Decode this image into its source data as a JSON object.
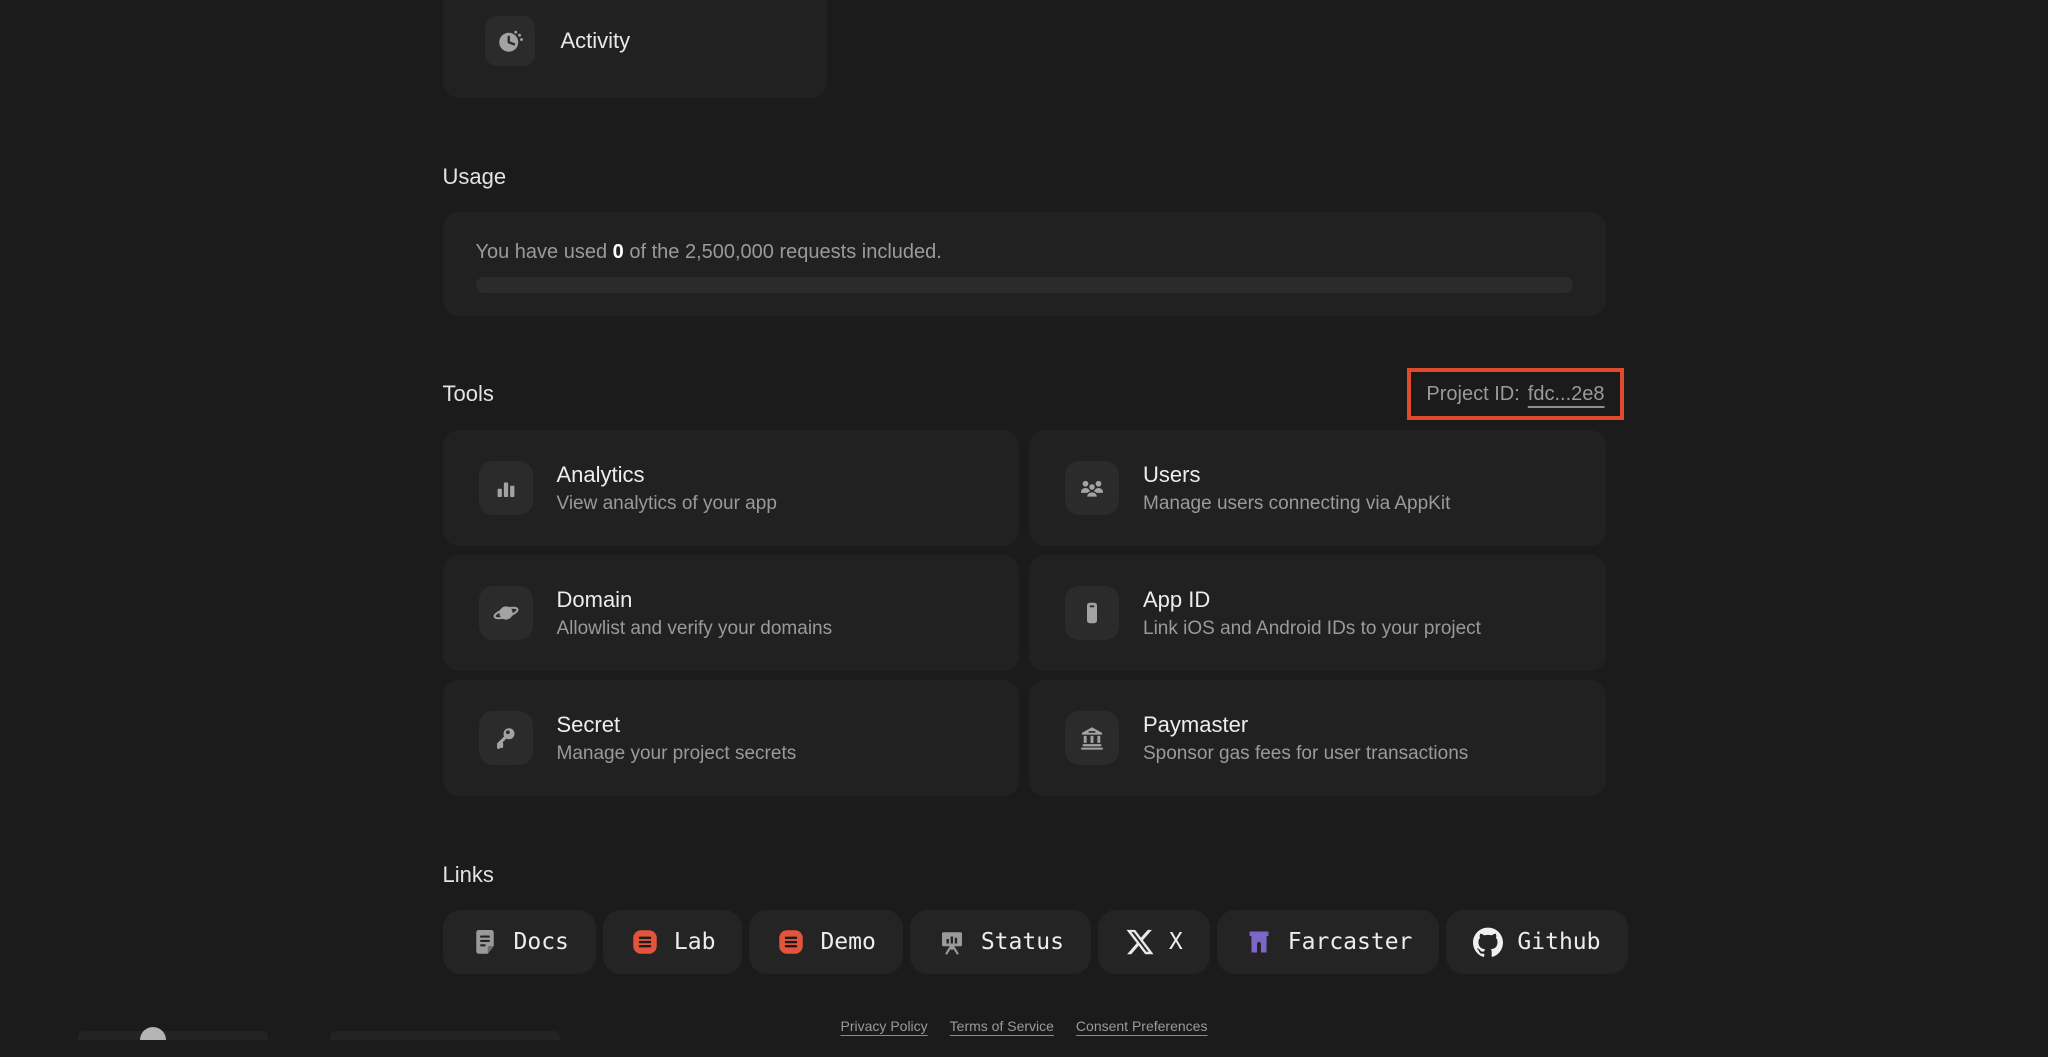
{
  "activity_card": {
    "label": "Activity",
    "icon": "activity-icon"
  },
  "usage": {
    "heading": "Usage",
    "text_prefix": "You have used ",
    "used_value": "0",
    "text_suffix": " of the 2,500,000 requests included.",
    "progress_percent": 0
  },
  "tools": {
    "heading": "Tools",
    "project_id": {
      "label": "Project ID:",
      "value": "fdc...2e8",
      "highlight_color": "#e04a2e"
    },
    "cards": [
      {
        "title": "Analytics",
        "description": "View analytics of your app",
        "icon": "analytics-icon"
      },
      {
        "title": "Users",
        "description": "Manage users connecting via AppKit",
        "icon": "users-icon"
      },
      {
        "title": "Domain",
        "description": "Allowlist and verify your domains",
        "icon": "domain-icon"
      },
      {
        "title": "App ID",
        "description": "Link iOS and Android IDs to your project",
        "icon": "app-id-icon"
      },
      {
        "title": "Secret",
        "description": "Manage your project secrets",
        "icon": "secret-icon"
      },
      {
        "title": "Paymaster",
        "description": "Sponsor gas fees for user transactions",
        "icon": "paymaster-icon"
      }
    ]
  },
  "links": {
    "heading": "Links",
    "items": [
      {
        "label": "Docs",
        "icon": "docs-icon",
        "icon_color": "#9a9a9a"
      },
      {
        "label": "Lab",
        "icon": "lab-icon",
        "icon_color": "#e2543c"
      },
      {
        "label": "Demo",
        "icon": "demo-icon",
        "icon_color": "#e2543c"
      },
      {
        "label": "Status",
        "icon": "status-icon",
        "icon_color": "#9a9a9a"
      },
      {
        "label": "X",
        "icon": "x-icon",
        "icon_color": "#e8e8e8"
      },
      {
        "label": "Farcaster",
        "icon": "farcaster-icon",
        "icon_color": "#7c66c8"
      },
      {
        "label": "Github",
        "icon": "github-icon",
        "icon_color": "#f0f0f0"
      }
    ]
  },
  "footer": {
    "links": [
      "Privacy Policy",
      "Terms of Service",
      "Consent Preferences"
    ]
  }
}
